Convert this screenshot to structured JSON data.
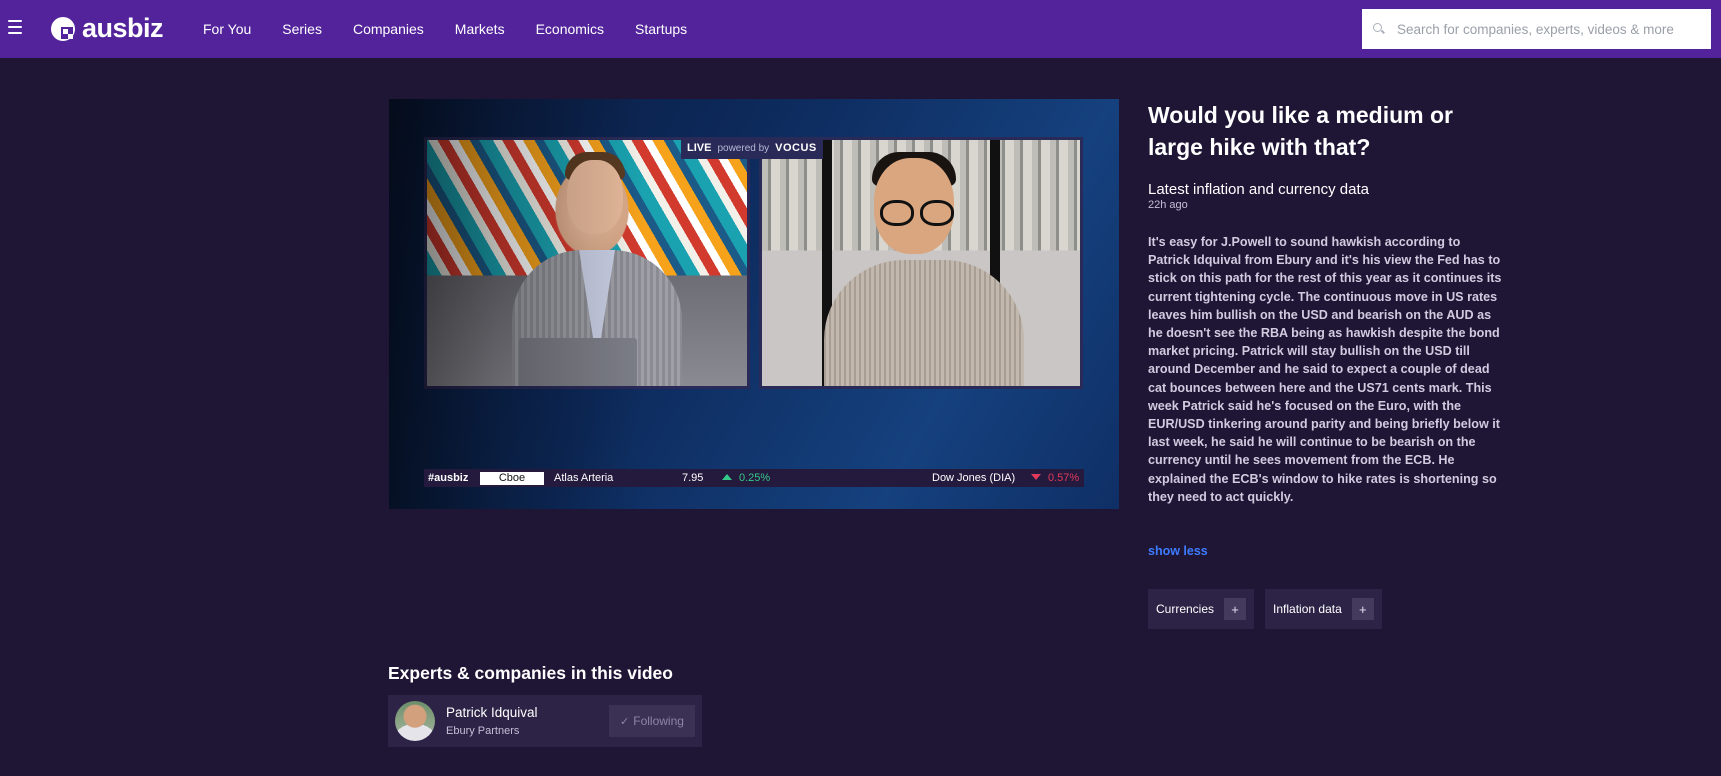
{
  "brand": {
    "name": "ausbiz"
  },
  "nav": {
    "items": [
      {
        "label": "For You"
      },
      {
        "label": "Series"
      },
      {
        "label": "Companies"
      },
      {
        "label": "Markets"
      },
      {
        "label": "Economics"
      },
      {
        "label": "Startups"
      }
    ]
  },
  "search": {
    "placeholder": "Search for companies, experts, videos & more",
    "value": ""
  },
  "video": {
    "live_label": "LIVE",
    "powered_by": "powered by",
    "sponsor": "VOCUS",
    "ticker": {
      "brand": "#ausbiz",
      "exchange": "Cboe",
      "stock_name": "Atlas Arteria",
      "stock_price": "7.95",
      "stock_change": "0.25%",
      "index_name": "Dow Jones (DIA)",
      "index_change": "0.57%"
    }
  },
  "article": {
    "title": "Would you like a medium or large hike with that?",
    "subtitle": "Latest inflation and currency data",
    "time": "22h ago",
    "description": "It's easy for J.Powell to sound hawkish according to Patrick Idquival from Ebury and it's his view the Fed has to stick on this path for the rest of this year as it continues its current tightening cycle. The continuous move in US rates leaves him bullish on the USD and bearish on the AUD as he doesn't see the RBA being as hawkish despite the bond market pricing. Patrick will stay bullish on the USD till around December and he said to expect a couple of dead cat bounces between here and the US71 cents mark. This week Patrick said he's focused on the Euro, with the EUR/USD tinkering around parity and being briefly below it last week, he said he will continue to be bearish on the currency until he sees movement from the ECB. He explained the ECB's window to hike rates is shortening so they need to act quickly.",
    "show_less": "show less",
    "tags": [
      {
        "label": "Currencies",
        "action": "+"
      },
      {
        "label": "Inflation data",
        "action": "+"
      }
    ]
  },
  "experts": {
    "heading": "Experts & companies in this video",
    "items": [
      {
        "name": "Patrick Idquival",
        "company": "Ebury Partners",
        "follow_check": "✓",
        "follow_label": "Following"
      }
    ]
  },
  "colors": {
    "topbar": "#52239a",
    "background": "#1f1535",
    "card": "#2c2346",
    "link": "#3d7cff",
    "up": "#35c98a",
    "down": "#e23a5a"
  }
}
